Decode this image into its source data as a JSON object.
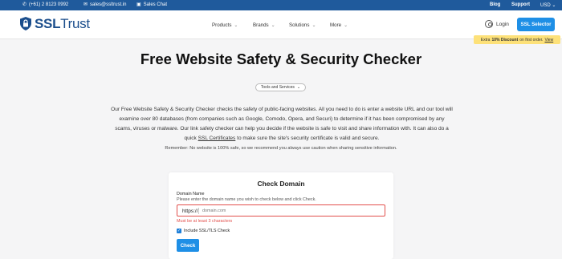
{
  "topbar": {
    "phone": "(+61) 2 8123 0992",
    "email": "sales@ssltrust.in",
    "chat": "Sales Chat",
    "blog": "Blog",
    "support": "Support",
    "currency": "USD",
    "icons": {
      "phone": "phone-icon",
      "email": "email-icon",
      "chat": "chat-icon",
      "currency": "chevron-down-icon"
    }
  },
  "header": {
    "logo_text_bold": "SSL",
    "logo_text": "Trust",
    "nav": [
      {
        "label": "Products"
      },
      {
        "label": "Brands"
      },
      {
        "label": "Solutions"
      },
      {
        "label": "More"
      }
    ],
    "login": "Login",
    "ssl_selector": "SSL Selector"
  },
  "promo": {
    "prefix": "Extra",
    "bold": "10% Discount",
    "suffix": "on first order.",
    "link": "View"
  },
  "hero": {
    "title": "Free Website Safety & Security Checker",
    "pill": "Tools and Services",
    "intro_1": "Our Free Website Safety & Security Checker checks the safety of public-facing websites. All you need to do is enter a website URL and our tool will examine over 80 databases (from companies such as Google, Comodo, Opera, and Securi) to determine if it has been compromised by any scams, viruses or malware. Our link safety checker can help you decide if the website is safe to visit and share information with. It can also do a quick ",
    "intro_link": "SSL Certificates",
    "intro_2": " to make sure the site's security certificate is valid and secure.",
    "remember": "Remember: No website is 100% safe, so we recommend you always use caution when sharing sensitive information."
  },
  "form": {
    "title": "Check Domain",
    "label": "Domain Name",
    "help": "Please enter the domain name you wish to check below and click Check.",
    "prefix": "https://",
    "placeholder": "domain.com",
    "value": "",
    "error": "Must be at least 3 characters",
    "checkbox_label": "Include SSL/TLS Check",
    "checkbox_checked": true,
    "button": "Check"
  },
  "colors": {
    "topbar": "#1f5a9c",
    "brand": "#1b4e8c",
    "accent": "#1e8fe6",
    "error": "#e2504c",
    "promo": "#fde179"
  }
}
